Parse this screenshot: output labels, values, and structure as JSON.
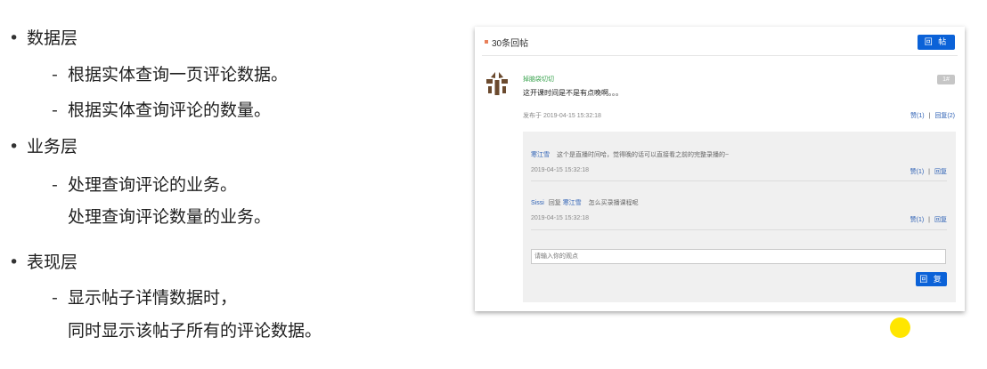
{
  "outline": {
    "items": [
      {
        "level": 1,
        "text": "数据层"
      },
      {
        "level": 2,
        "text": "根据实体查询一页评论数据。"
      },
      {
        "level": 2,
        "text": "根据实体查询评论的数量。"
      },
      {
        "level": 1,
        "text": "业务层"
      },
      {
        "level": 2,
        "text": "处理查询评论的业务。"
      },
      {
        "level": 3,
        "text": "处理查询评论数量的业务。"
      },
      {
        "level": 1,
        "text": "表现层"
      },
      {
        "level": 2,
        "text": "显示帖子详情数据时，"
      },
      {
        "level": 3,
        "text": "同时显示该帖子所有的评论数据。"
      }
    ],
    "bullet": "•",
    "dash": "-"
  },
  "panel": {
    "header": {
      "count_label": "30条回帖",
      "post_button": "回 帖"
    },
    "post": {
      "author": "掉脑袋切切",
      "text": "这开课时间是不是有点晚啊。。。",
      "floor": "1#",
      "meta": "发布于 2019-04-15 15:32:18",
      "like": "赞(1)",
      "separator": "|",
      "reply": "回复(2)"
    },
    "replies": [
      {
        "user": "寒江雪",
        "text": "这个是直播时间哈，觉得晚的话可以直接看之前的完整录播的~",
        "time": "2019-04-15 15:32:18",
        "like": "赞(1)",
        "reply": "回复"
      },
      {
        "user": "Sissi",
        "reply_word": "回复",
        "target": "寒江雪",
        "text": "怎么买录播课程呢",
        "time": "2019-04-15 15:32:18",
        "like": "赞(1)",
        "reply": "回复"
      }
    ],
    "input_placeholder": "请输入你的观点",
    "reply_button": "回 复"
  },
  "colors": {
    "primary": "#0b62d8",
    "link": "#2b5fb4",
    "author_green": "#3aa34f",
    "marker": "#e8805a",
    "laser": "#ffe600"
  }
}
